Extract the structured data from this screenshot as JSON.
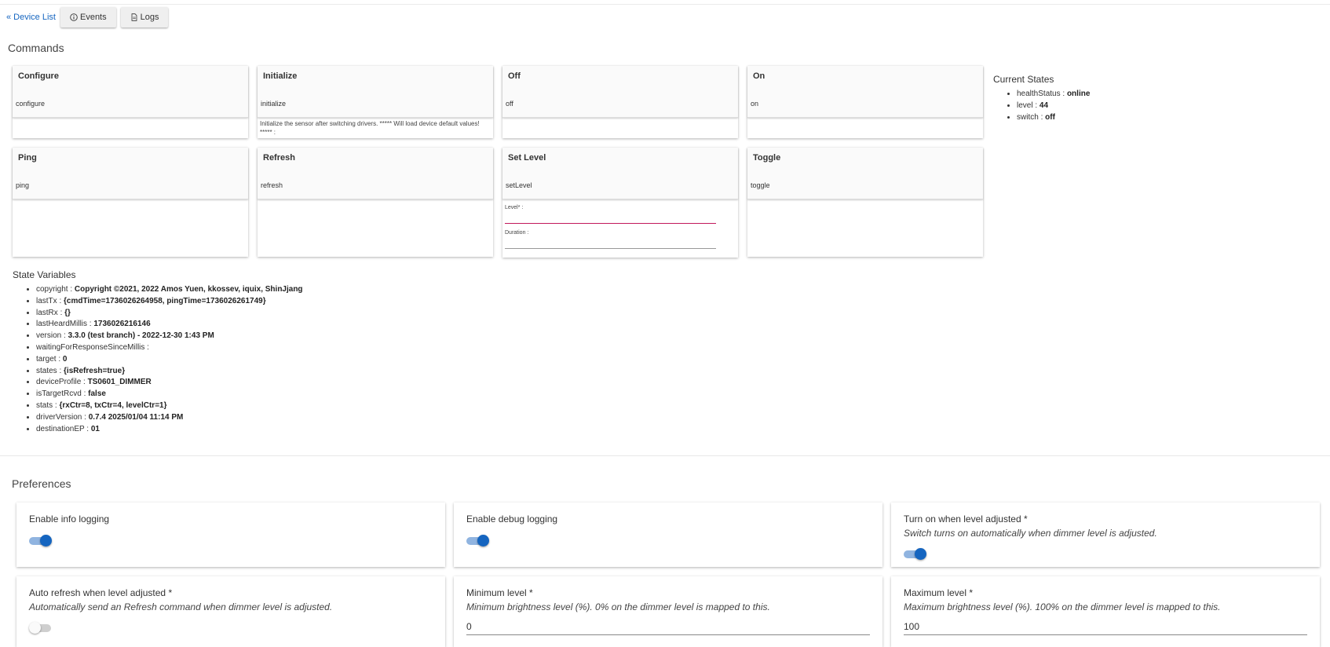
{
  "nav": {
    "device_list": "« Device List",
    "events": "Events",
    "logs": "Logs"
  },
  "commands": {
    "title": "Commands",
    "items": [
      {
        "title": "Configure",
        "fn": "configure",
        "desc": ""
      },
      {
        "title": "Initialize",
        "fn": "initialize",
        "desc": "Initialize the sensor after switching drivers. ***** Will load device default values! ***** :"
      },
      {
        "title": "Off",
        "fn": "off",
        "desc": ""
      },
      {
        "title": "On",
        "fn": "on",
        "desc": ""
      },
      {
        "title": "Ping",
        "fn": "ping",
        "desc": ""
      },
      {
        "title": "Refresh",
        "fn": "refresh",
        "desc": ""
      },
      {
        "title": "Set Level",
        "fn": "setLevel",
        "desc": ""
      },
      {
        "title": "Toggle",
        "fn": "toggle",
        "desc": ""
      }
    ],
    "setlevel_fields": {
      "level": "Level* :",
      "duration": "Duration :"
    }
  },
  "current_states": {
    "title": "Current States",
    "items": [
      {
        "key": "healthStatus",
        "value": "online"
      },
      {
        "key": "level",
        "value": "44"
      },
      {
        "key": "switch",
        "value": "off"
      }
    ]
  },
  "state_variables": {
    "title": "State Variables",
    "items": [
      {
        "key": "copyright",
        "value": "Copyright ©2021, 2022 Amos Yuen, kkossev, iquix, ShinJjang"
      },
      {
        "key": "lastTx",
        "value": "{cmdTime=1736026264958, pingTime=1736026261749}"
      },
      {
        "key": "lastRx",
        "value": "{}"
      },
      {
        "key": "lastHeardMillis",
        "value": "1736026216146"
      },
      {
        "key": "version",
        "value": "3.3.0 (test branch) - 2022-12-30 1:43 PM"
      },
      {
        "key": "waitingForResponseSinceMillis",
        "value": ""
      },
      {
        "key": "target",
        "value": "0"
      },
      {
        "key": "states",
        "value": "{isRefresh=true}"
      },
      {
        "key": "deviceProfile",
        "value": "TS0601_DIMMER"
      },
      {
        "key": "isTargetRcvd",
        "value": "false"
      },
      {
        "key": "stats",
        "value": "{rxCtr=8, txCtr=4, levelCtr=1}"
      },
      {
        "key": "driverVersion",
        "value": "0.7.4 2025/01/04 11:14 PM"
      },
      {
        "key": "destinationEP",
        "value": "01"
      }
    ]
  },
  "preferences": {
    "title": "Preferences",
    "items": [
      {
        "title": "Enable info logging",
        "desc": "",
        "toggle": true
      },
      {
        "title": "Enable debug logging",
        "desc": "",
        "toggle": true
      },
      {
        "title": "Turn on when level adjusted *",
        "desc": "Switch turns on automatically when dimmer level is adjusted.",
        "toggle": true
      },
      {
        "title": "Auto refresh when level adjusted *",
        "desc": "Automatically send an Refresh command when dimmer level is adjusted.",
        "toggle": false
      },
      {
        "title": "Minimum level *",
        "desc": "Minimum brightness level (%). 0% on the dimmer level is mapped to this.",
        "value": "0"
      },
      {
        "title": "Maximum level *",
        "desc": "Maximum brightness level (%). 100% on the dimmer level is mapped to this.",
        "value": "100"
      }
    ]
  },
  "colors": {
    "accent": "#1565c0",
    "link": "#1565c0",
    "error_underline": "#c2185b"
  }
}
